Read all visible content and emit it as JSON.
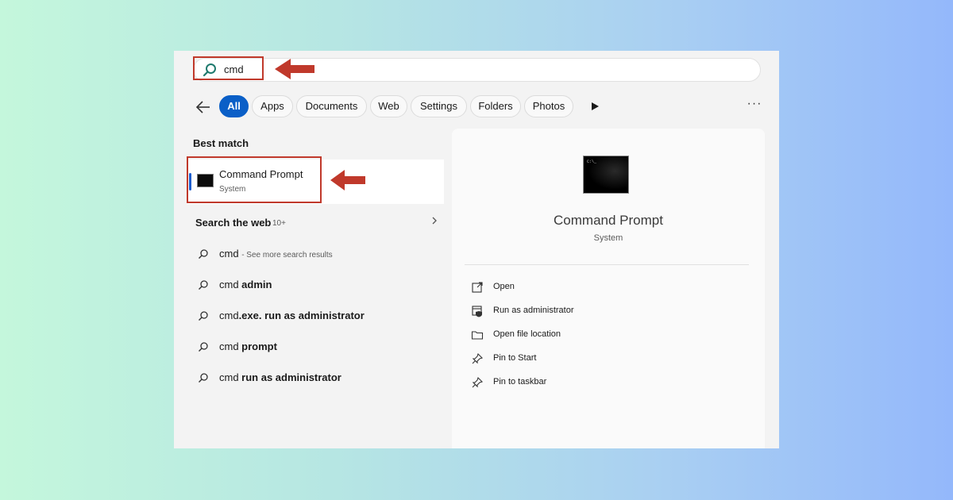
{
  "search": {
    "query": "cmd"
  },
  "filters": {
    "chips": [
      "All",
      "Apps",
      "Documents",
      "Web",
      "Settings",
      "Folders",
      "Photos"
    ],
    "more": "···"
  },
  "best_match": {
    "title": "Best match",
    "item": {
      "name": "Command Prompt",
      "type": "System"
    }
  },
  "web": {
    "title": "Search the web",
    "count": "10+",
    "results": [
      {
        "term": "cmd",
        "suffix": "",
        "hint": "- See more search results"
      },
      {
        "term": "cmd",
        "suffix": " admin",
        "hint": ""
      },
      {
        "term": "cmd",
        "suffix": ".exe. run as administrator",
        "hint": ""
      },
      {
        "term": "cmd",
        "suffix": " prompt",
        "hint": ""
      },
      {
        "term": "cmd",
        "suffix": " run as administrator",
        "hint": ""
      }
    ]
  },
  "preview": {
    "name": "Command Prompt",
    "type": "System",
    "actions": [
      {
        "label": "Open",
        "icon": "open-external-icon"
      },
      {
        "label": "Run as administrator",
        "icon": "shield-window-icon"
      },
      {
        "label": "Open file location",
        "icon": "folder-icon"
      },
      {
        "label": "Pin to Start",
        "icon": "pin-icon"
      },
      {
        "label": "Pin to taskbar",
        "icon": "pin-icon"
      }
    ]
  },
  "colors": {
    "accent": "#0a5fc7",
    "annotation": "#c0392b"
  }
}
